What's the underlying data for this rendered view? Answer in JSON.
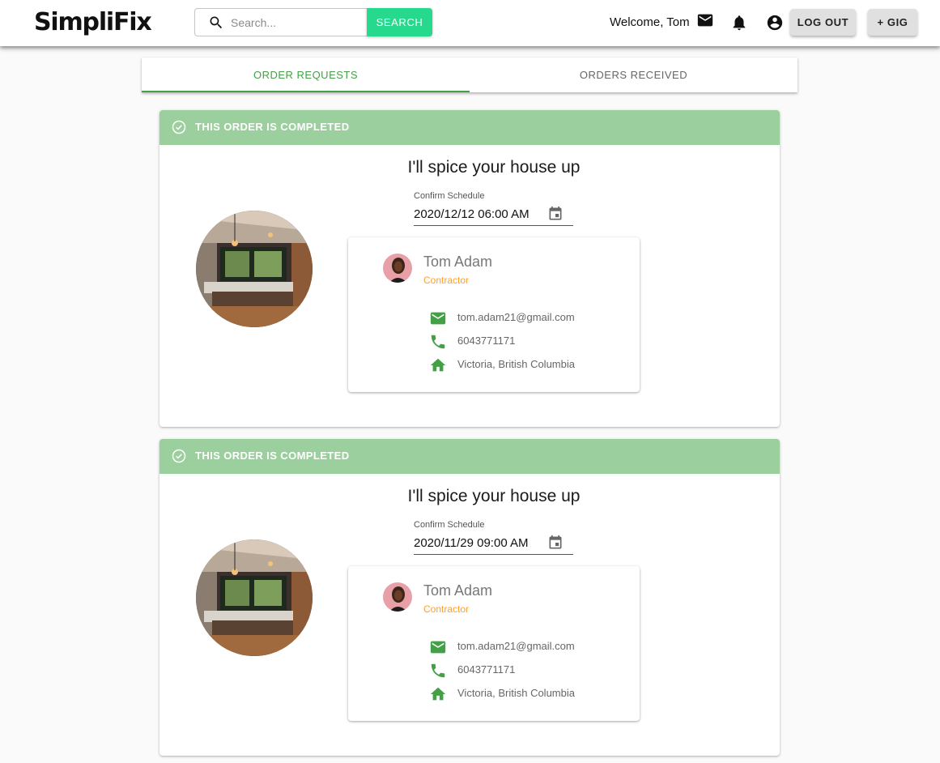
{
  "colors": {
    "accent_green": "#43a047",
    "search_button": "#27d98c",
    "banner_green": "#9ccf9e",
    "role_orange": "#ff9f2b",
    "icon_green": "#43a047"
  },
  "header": {
    "logo": "SimpliFix",
    "search": {
      "placeholder": "Search...",
      "value": "",
      "button_label": "SEARCH",
      "icon": "search-icon"
    },
    "welcome_text": "Welcome, Tom",
    "icons": [
      "mail-icon",
      "bell-icon",
      "account-circle-icon"
    ],
    "logout_label": "LOG OUT",
    "add_gig_label": "+ GIG"
  },
  "tabs": [
    {
      "label": "ORDER REQUESTS",
      "active": true
    },
    {
      "label": "ORDERS RECEIVED",
      "active": false
    }
  ],
  "orders": [
    {
      "status_text": "THIS ORDER IS COMPLETED",
      "gig_title": "I'll spice your house up",
      "schedule_label": "Confirm Schedule",
      "schedule_value": "2020/12/12 06:00 AM",
      "user": {
        "name": "Tom Adam",
        "role": "Contractor",
        "email": "tom.adam21@gmail.com",
        "phone": "6043771171",
        "location": "Victoria, British Columbia"
      }
    },
    {
      "status_text": "THIS ORDER IS COMPLETED",
      "gig_title": "I'll spice your house up",
      "schedule_label": "Confirm Schedule",
      "schedule_value": "2020/11/29 09:00 AM",
      "user": {
        "name": "Tom Adam",
        "role": "Contractor",
        "email": "tom.adam21@gmail.com",
        "phone": "6043771171",
        "location": "Victoria, British Columbia"
      }
    }
  ]
}
